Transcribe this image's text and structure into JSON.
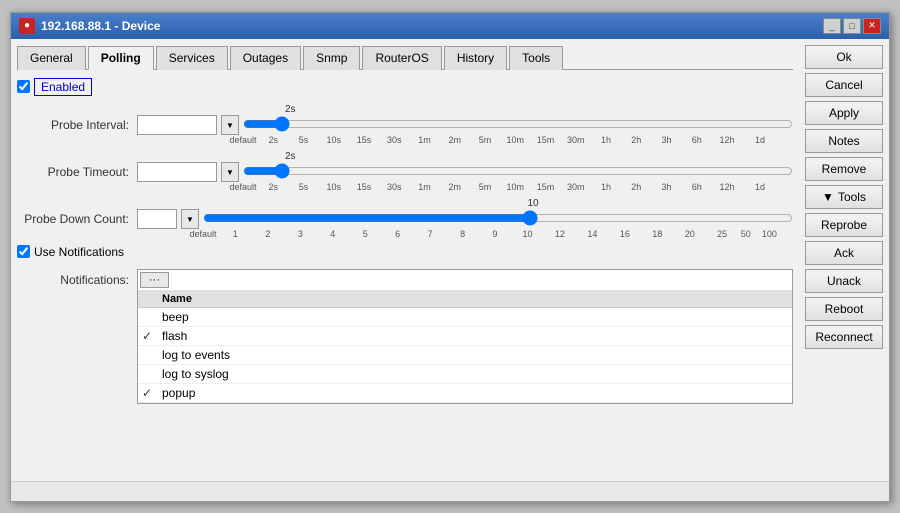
{
  "window": {
    "title": "192.168.88.1 - Device",
    "icon": "●"
  },
  "tabs": [
    {
      "label": "General",
      "active": false
    },
    {
      "label": "Polling",
      "active": true
    },
    {
      "label": "Services",
      "active": false
    },
    {
      "label": "Outages",
      "active": false
    },
    {
      "label": "Snmp",
      "active": false
    },
    {
      "label": "RouterOS",
      "active": false
    },
    {
      "label": "History",
      "active": false
    },
    {
      "label": "Tools",
      "active": false
    }
  ],
  "polling": {
    "enabled_label": "Enabled",
    "probe_interval_label": "Probe Interval:",
    "probe_interval_value": "00:00:02",
    "probe_timeout_label": "Probe Timeout:",
    "probe_timeout_value": "00:00:02",
    "probe_down_count_label": "Probe Down Count:",
    "probe_down_count_value": "10",
    "use_notifications_label": "Use Notifications",
    "notifications_label": "Notifications:",
    "slider1": {
      "label_above": "2s",
      "label_above_pos": 42,
      "ticks": [
        "default",
        "2s",
        "5s",
        "10s",
        "15s",
        "30s",
        "1m",
        "2m",
        "5m",
        "10m",
        "15m",
        "30m",
        "1h",
        "2h",
        "3h",
        "6h",
        "12h",
        "1d"
      ]
    },
    "slider2": {
      "label_above": "2s",
      "label_above_pos": 42,
      "ticks": [
        "default",
        "2s",
        "5s",
        "10s",
        "15s",
        "30s",
        "1m",
        "2m",
        "5m",
        "10m",
        "15m",
        "30m",
        "1h",
        "2h",
        "3h",
        "6h",
        "12h",
        "1d"
      ]
    },
    "slider3": {
      "label_above": "10",
      "label_above_pos": 55,
      "ticks": [
        "default",
        "1",
        "2",
        "3",
        "4",
        "5",
        "6",
        "7",
        "8",
        "9",
        "10",
        "12",
        "14",
        "16",
        "18",
        "20",
        "25",
        "50",
        "100"
      ]
    }
  },
  "notifications_list": {
    "toolbar_btn": "···",
    "header_name": "Name",
    "items": [
      {
        "name": "beep",
        "checked": false
      },
      {
        "name": "flash",
        "checked": true
      },
      {
        "name": "log to events",
        "checked": false
      },
      {
        "name": "log to syslog",
        "checked": false
      },
      {
        "name": "popup",
        "checked": true
      }
    ]
  },
  "sidebar": {
    "buttons": [
      {
        "label": "Ok",
        "name": "ok-button"
      },
      {
        "label": "Cancel",
        "name": "cancel-button"
      },
      {
        "label": "Apply",
        "name": "apply-button"
      },
      {
        "label": "Notes",
        "name": "notes-button"
      },
      {
        "label": "Remove",
        "name": "remove-button"
      },
      {
        "label": "▼ Tools",
        "name": "tools-button"
      },
      {
        "label": "Reprobe",
        "name": "reprobe-button"
      },
      {
        "label": "Ack",
        "name": "ack-button"
      },
      {
        "label": "Unack",
        "name": "unack-button"
      },
      {
        "label": "Reboot",
        "name": "reboot-button"
      },
      {
        "label": "Reconnect",
        "name": "reconnect-button"
      }
    ]
  },
  "status_bar": {
    "text": ""
  }
}
